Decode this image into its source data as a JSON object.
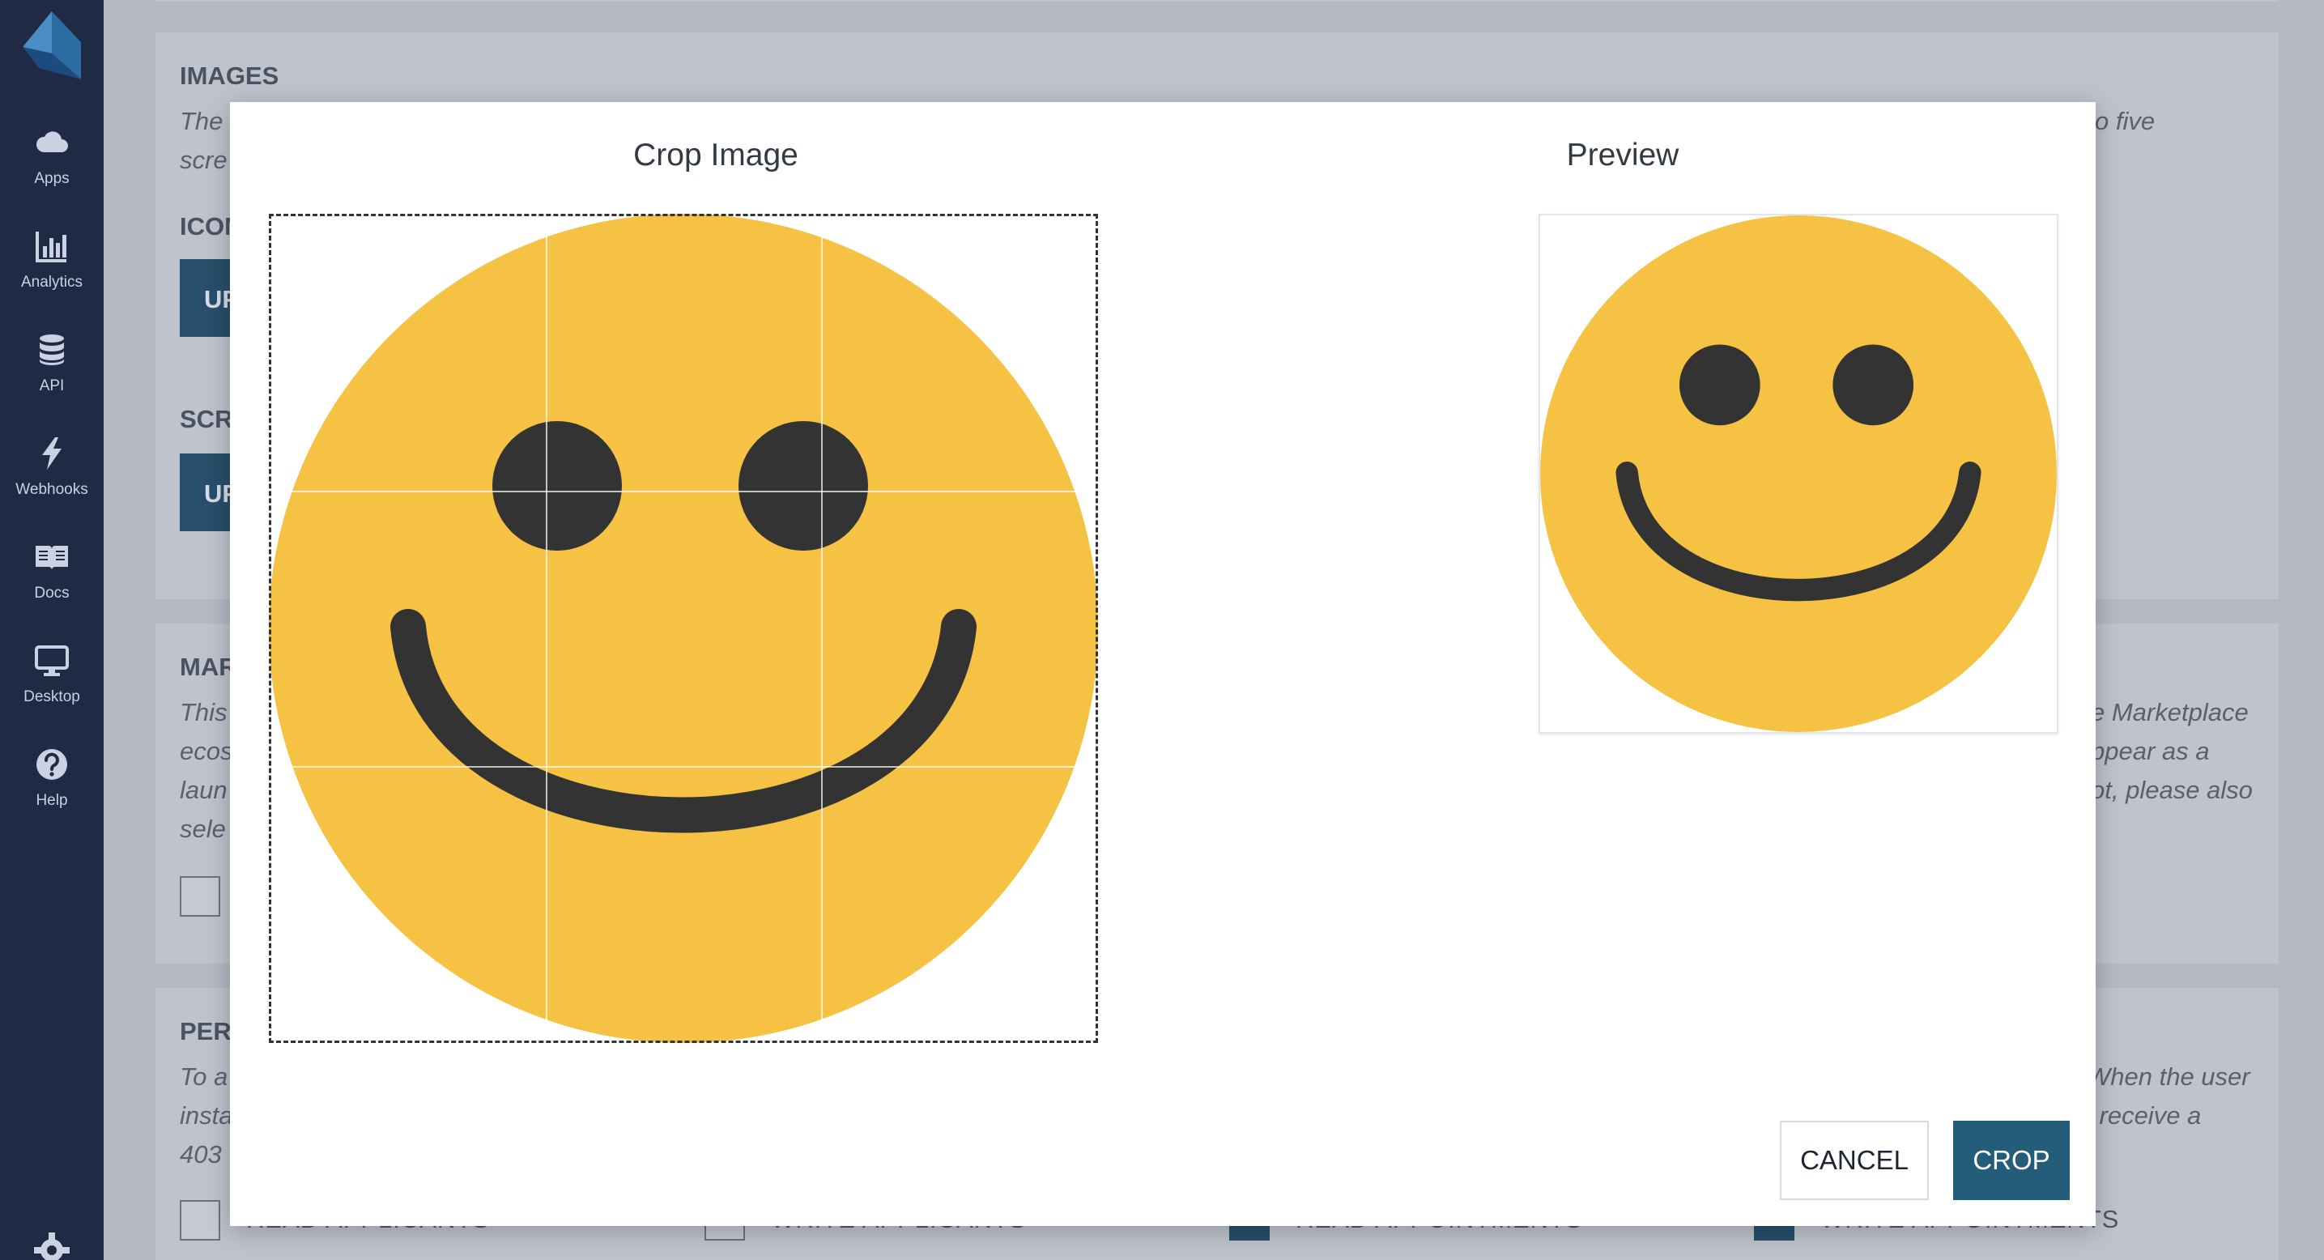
{
  "sidebar": {
    "items": [
      {
        "label": "Apps",
        "icon": "cloud-icon",
        "active": true
      },
      {
        "label": "Analytics",
        "icon": "bar-chart-icon",
        "active": false
      },
      {
        "label": "API",
        "icon": "database-icon",
        "active": false
      },
      {
        "label": "Webhooks",
        "icon": "lightning-icon",
        "active": false
      },
      {
        "label": "Docs",
        "icon": "open-book-icon",
        "active": false
      },
      {
        "label": "Desktop",
        "icon": "monitor-icon",
        "active": false
      },
      {
        "label": "Help",
        "icon": "question-circle-icon",
        "active": false
      }
    ],
    "bottom_icon": "gear-icon"
  },
  "background": {
    "images_heading": "IMAGES",
    "images_text_line1_left": "The",
    "images_text_line1_right": "o five",
    "images_text_line2_left": "scre",
    "icon_heading": "ICON",
    "icon_upload_label": "UP",
    "screenshots_heading": "SCRE",
    "screenshots_upload_label": "UP",
    "mar_heading": "MAR",
    "mar_lines_left": [
      "This",
      "ecos",
      "laun",
      "sele"
    ],
    "mar_lines_right": [
      "e Marketplace",
      "ppear as a",
      "ot, please also"
    ],
    "perm_heading": "PERI",
    "perm_lines_left": [
      "To a",
      "insta",
      "403"
    ],
    "perm_lines_right": [
      "When the user",
      "l receive a"
    ],
    "permissions": [
      {
        "label": "READ APPLICANTS",
        "checked": false
      },
      {
        "label": "WRITE APPLICANTS",
        "checked": false
      },
      {
        "label": "READ APPOINTMENTS",
        "checked": true
      },
      {
        "label": "WRITE APPOINTMENTS",
        "checked": true
      }
    ]
  },
  "modal": {
    "crop_title": "Crop Image",
    "preview_title": "Preview",
    "cancel_label": "CANCEL",
    "crop_label": "CROP"
  },
  "colors": {
    "sidebar": "#1f2a44",
    "smiley_face": "#f6c244",
    "smiley_features": "#333333",
    "primary_button": "#235d7a"
  }
}
